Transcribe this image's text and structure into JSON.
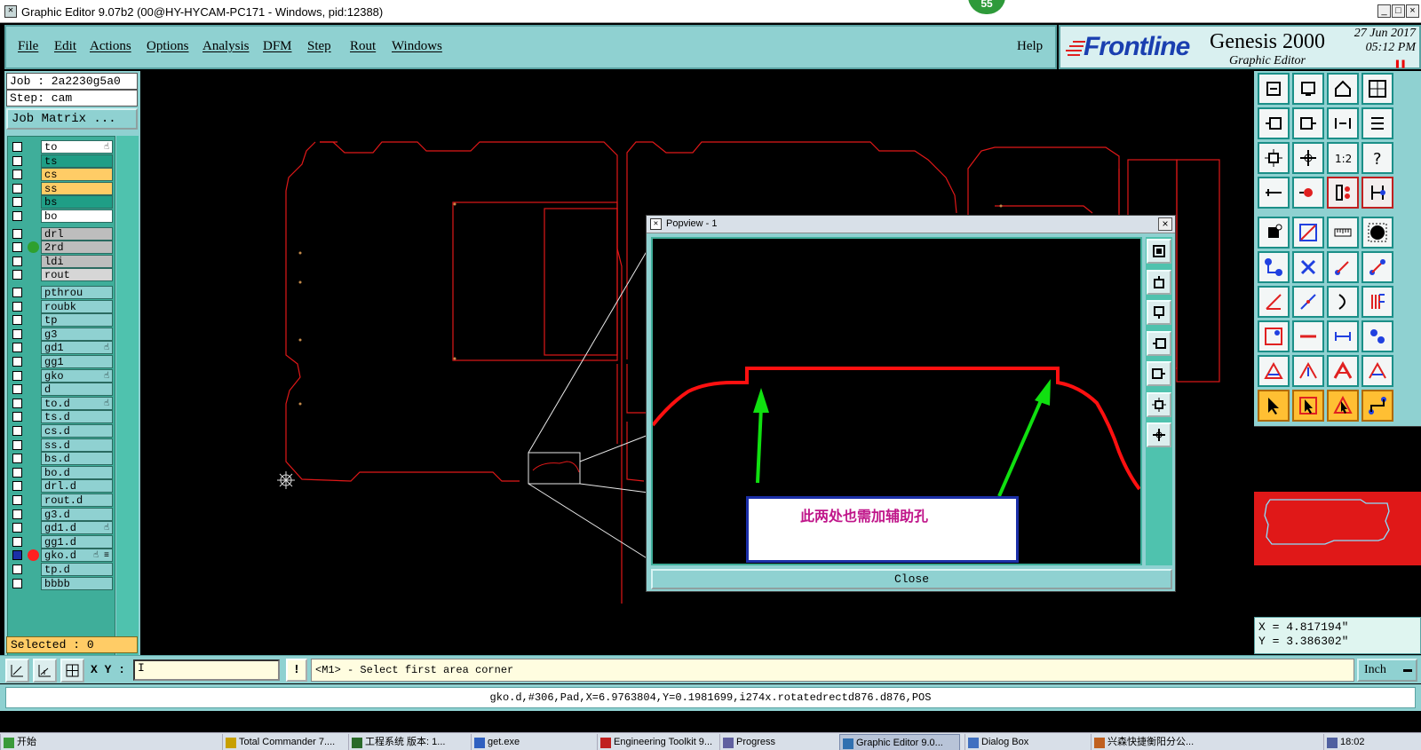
{
  "window": {
    "title": "Graphic Editor 9.07b2 (00@HY-HYCAM-PC171 - Windows, pid:12388)",
    "badge": "55",
    "min_label": "_",
    "max_label": "□",
    "close_label": "×"
  },
  "menu": {
    "file": "File",
    "edit": "Edit",
    "actions": "Actions",
    "options": "Options",
    "analysis": "Analysis",
    "dfm": "DFM",
    "step": "Step",
    "rout": "Rout",
    "windows": "Windows",
    "help": "Help"
  },
  "logo": {
    "brand": "Frontline",
    "product": "Genesis 2000",
    "subtitle": "Graphic Editor",
    "date": "27 Jun 2017",
    "time": "05:12 PM"
  },
  "job": {
    "job_line": "Job : 2a2230g5a0",
    "step_line": "Step: cam",
    "matrix_label": "Job Matrix ...",
    "selected_line": "Selected : 0"
  },
  "layers": [
    {
      "name": "to",
      "color": "#ffffff",
      "affected": "☝"
    },
    {
      "name": "ts",
      "color": "#1f9e86"
    },
    {
      "name": "cs",
      "color": "#ffcc66"
    },
    {
      "name": "ss",
      "color": "#ffcc66"
    },
    {
      "name": "bs",
      "color": "#1f9e86"
    },
    {
      "name": "bo",
      "color": "#ffffff"
    },
    {
      "name": "drl",
      "color": "#bdbdbd"
    },
    {
      "name": "2rd",
      "color": "#bdbdbd",
      "dot": "#2ea02e"
    },
    {
      "name": "ldi",
      "color": "#bdbdbd"
    },
    {
      "name": "rout",
      "color": "#d6d6d6"
    },
    {
      "name": "pthrou",
      "color": "#8fd1d1"
    },
    {
      "name": "roubk",
      "color": "#8fd1d1"
    },
    {
      "name": "tp",
      "color": "#8fd1d1"
    },
    {
      "name": "g3",
      "color": "#8fd1d1"
    },
    {
      "name": "gd1",
      "color": "#8fd1d1",
      "affected": "☝"
    },
    {
      "name": "gg1",
      "color": "#8fd1d1"
    },
    {
      "name": "gko",
      "color": "#8fd1d1",
      "affected": "☝"
    },
    {
      "name": "d",
      "color": "#8fd1d1"
    },
    {
      "name": "to.d",
      "color": "#8fd1d1",
      "affected": "☝"
    },
    {
      "name": "ts.d",
      "color": "#8fd1d1"
    },
    {
      "name": "cs.d",
      "color": "#8fd1d1"
    },
    {
      "name": "ss.d",
      "color": "#8fd1d1"
    },
    {
      "name": "bs.d",
      "color": "#8fd1d1"
    },
    {
      "name": "bo.d",
      "color": "#8fd1d1"
    },
    {
      "name": "drl.d",
      "color": "#8fd1d1"
    },
    {
      "name": "rout.d",
      "color": "#8fd1d1"
    },
    {
      "name": "g3.d",
      "color": "#8fd1d1"
    },
    {
      "name": "gd1.d",
      "color": "#8fd1d1",
      "affected": "☝"
    },
    {
      "name": "gg1.d",
      "color": "#8fd1d1"
    },
    {
      "name": "gko.d",
      "color": "#8fd1d1",
      "dot": "#ff2020",
      "checked": true,
      "affected": "☝ ≡"
    },
    {
      "name": "tp.d",
      "color": "#8fd1d1"
    },
    {
      "name": "bbbb",
      "color": "#8fd1d1"
    }
  ],
  "coords": {
    "x_line": "X = 4.817194\"",
    "y_line": "Y = 3.386302\""
  },
  "command": {
    "xy_label": "X Y :",
    "xy_value": "I",
    "warn_label": "!",
    "prompt": "<M1> - Select first area corner",
    "units": "Inch",
    "units_arrow": "▬"
  },
  "status": {
    "text": "gko.d,#306,Pad,X=6.9763804,Y=0.1981699,i274x.rotatedrectd876.d876,POS"
  },
  "popview": {
    "title": "Popview - 1",
    "close_x": "×",
    "note": "此两处也需加辅助孔",
    "close_label": "Close"
  },
  "taskbar": [
    {
      "label": "开始",
      "icon": "start-icon"
    },
    {
      "label": "Total Commander 7....",
      "icon": "tc-icon"
    },
    {
      "label": "工程系统 版本: 1...",
      "icon": "eng-icon"
    },
    {
      "label": "get.exe",
      "icon": "exe-icon"
    },
    {
      "label": "Engineering Toolkit 9...",
      "icon": "toolkit-icon"
    },
    {
      "label": "Progress",
      "icon": "progress-icon"
    },
    {
      "label": "Graphic Editor 9.0...",
      "icon": "ge-icon",
      "active": true
    },
    {
      "label": "Dialog Box",
      "icon": "dialog-icon"
    },
    {
      "label": "兴森快捷衡阳分公...",
      "icon": "company-icon"
    },
    {
      "label": "18:02",
      "icon": "clock-icon"
    }
  ],
  "colors": {
    "panel": "#8fd1d1",
    "outline": "#ff2020",
    "accent_green": "#10e010",
    "note_text": "#c0168a"
  }
}
